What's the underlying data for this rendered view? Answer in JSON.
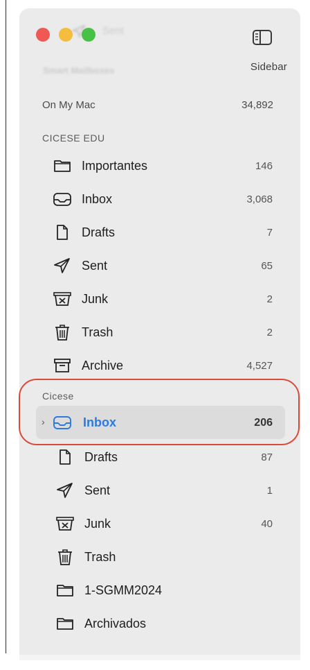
{
  "toolbar": {
    "sidebar_label": "Sidebar",
    "sidebar_icon": "sidebar-toggle-icon"
  },
  "ghost": {
    "sent_label": "Sent",
    "smart_mailboxes": "Smart Mailboxes"
  },
  "on_my_mac": {
    "label": "On My Mac",
    "count": "34,892"
  },
  "accounts": [
    {
      "name": "CICESE EDU",
      "mailboxes": [
        {
          "label": "Importantes",
          "count": "146",
          "icon": "folder-icon"
        },
        {
          "label": "Inbox",
          "count": "3,068",
          "icon": "inbox-icon"
        },
        {
          "label": "Drafts",
          "count": "7",
          "icon": "document-icon"
        },
        {
          "label": "Sent",
          "count": "65",
          "icon": "paper-plane-icon"
        },
        {
          "label": "Junk",
          "count": "2",
          "icon": "junk-icon"
        },
        {
          "label": "Trash",
          "count": "2",
          "icon": "trash-icon"
        },
        {
          "label": "Archive",
          "count": "4,527",
          "icon": "archive-icon"
        }
      ]
    },
    {
      "name": "Cicese",
      "mailboxes": [
        {
          "label": "Inbox",
          "count": "206",
          "icon": "inbox-icon",
          "selected": true
        },
        {
          "label": "Drafts",
          "count": "87",
          "icon": "document-icon"
        },
        {
          "label": "Sent",
          "count": "1",
          "icon": "paper-plane-icon"
        },
        {
          "label": "Junk",
          "count": "40",
          "icon": "junk-icon"
        },
        {
          "label": "Trash",
          "count": "",
          "icon": "trash-icon"
        },
        {
          "label": "1-SGMM2024",
          "count": "",
          "icon": "folder-icon"
        },
        {
          "label": "Archivados",
          "count": "",
          "icon": "folder-icon"
        }
      ]
    }
  ],
  "colors": {
    "selected_text": "#2a7ae2",
    "highlight_oval": "#d94a3a",
    "sidebar_bg": "#ebebeb"
  }
}
